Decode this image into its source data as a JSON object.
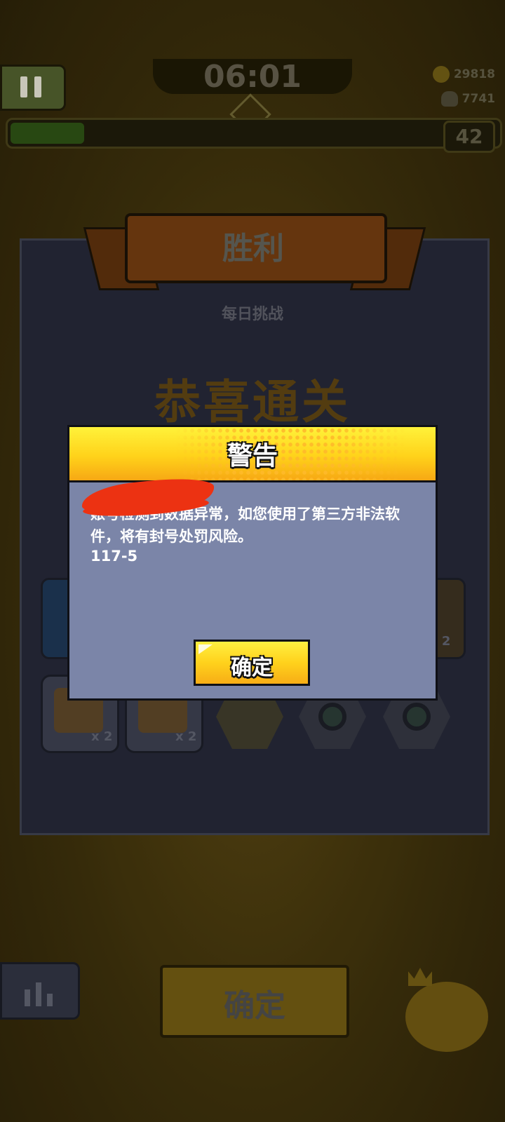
{
  "hud": {
    "timer": "06:01",
    "coins": "29818",
    "kills": "7741",
    "level": "42",
    "xp_progress": 0.15
  },
  "result_panel": {
    "ribbon_title": "胜利",
    "mode": "每日挑战",
    "headline": "恭喜通关",
    "items": [
      {
        "icon": "glove-icon",
        "multiplier": "x 2"
      },
      {
        "icon": "necklace-icon",
        "multiplier": "x 2"
      },
      {
        "icon": "shirt-icon",
        "multiplier": ""
      },
      {
        "icon": "gear-ring-icon",
        "multiplier": ""
      },
      {
        "icon": "disc-icon",
        "multiplier": ""
      }
    ],
    "side_multiplier_right": "x 2"
  },
  "bottom": {
    "confirm_label": "确定"
  },
  "dialog": {
    "title": "警告",
    "message": "账号检测到数据异常，如您使用了第三方非法软件，将有封号处罚风险。",
    "code": "117-5",
    "confirm_label": "确定"
  },
  "colors": {
    "dialog_header": "#ffd21a",
    "dialog_body": "#7b85a8",
    "redaction": "#ec3212"
  }
}
